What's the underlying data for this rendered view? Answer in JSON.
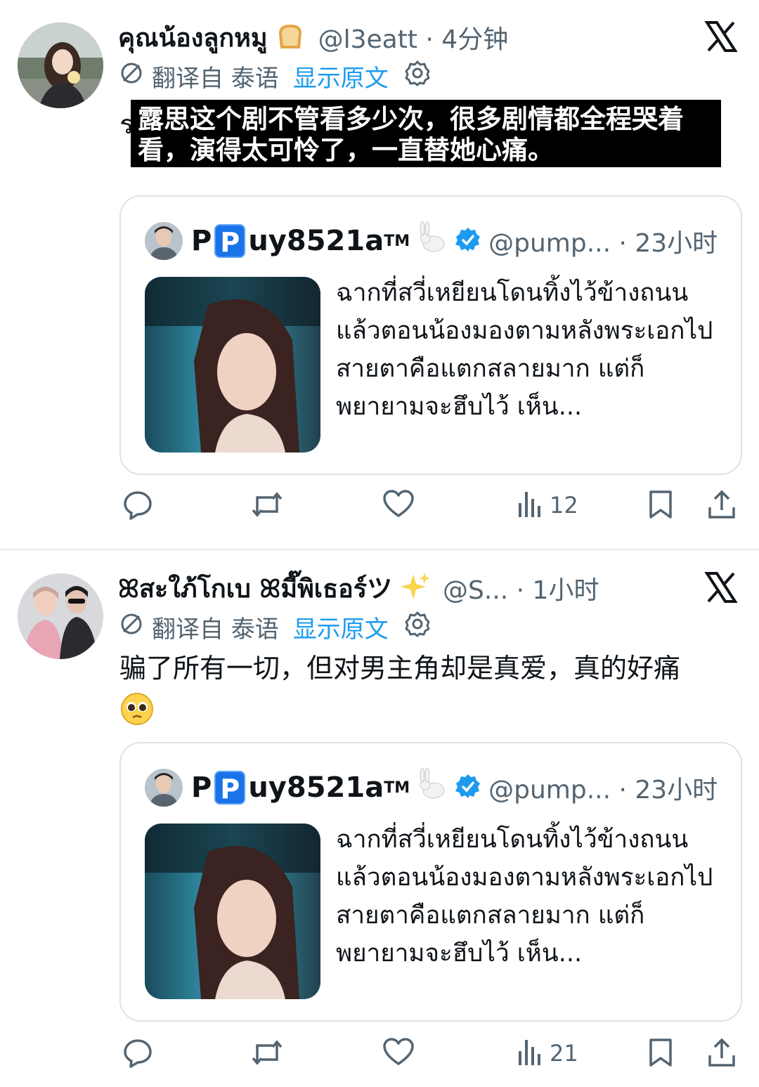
{
  "tweets": [
    {
      "display_name": "คุณน้องลูกหมู",
      "emoji": "bread-emoji",
      "handle_time": "@l3eatt · 4分钟",
      "translate_label": "翻译自 泰语",
      "translate_link": "显示原文",
      "subtitle": "露思这个剧不管看多少次，很多剧情都全程哭着看，演得太可怜了，一直替她心痛。",
      "under_text": "ร",
      "quote": {
        "name_prefix": "P",
        "badge": "P",
        "name_suffix": "uy8521a",
        "tm": "TM",
        "handle_time": "@pump... · 23小时",
        "text": "ฉากที่สวี่เหยียนโดนทิ้งไว้ข้างถนน แล้วตอนน้องมองตามหลังพระเอกไปสายตาคือแตกสลายมาก แต่ก็พยายามจะฮึบไว้ เห็น..."
      },
      "views": "12"
    },
    {
      "display_name": "ꕤสะใภ้โกเบ ꕤมี๊พิเธอร์ツ",
      "emoji": "sparkles-emoji",
      "handle_time": "@S... · 1小时",
      "translate_label": "翻译自 泰语",
      "translate_link": "显示原文",
      "body": "骗了所有一切，但对男主角却是真爱，真的好痛",
      "body_emoji": "pleading-face-emoji",
      "quote": {
        "name_prefix": "P",
        "badge": "P",
        "name_suffix": "uy8521a",
        "tm": "TM",
        "handle_time": "@pump... · 23小时",
        "text": "ฉากที่สวี่เหยียนโดนทิ้งไว้ข้างถนน แล้วตอนน้องมองตามหลังพระเอกไปสายตาคือแตกสลายมาก แต่ก็พยายามจะฮึบไว้ เห็น..."
      },
      "views": "21"
    }
  ],
  "colors": {
    "link": "#1d9bf0",
    "secondary_text": "#536471",
    "verified": "#1d9bf0",
    "border": "#dfe3e7"
  }
}
